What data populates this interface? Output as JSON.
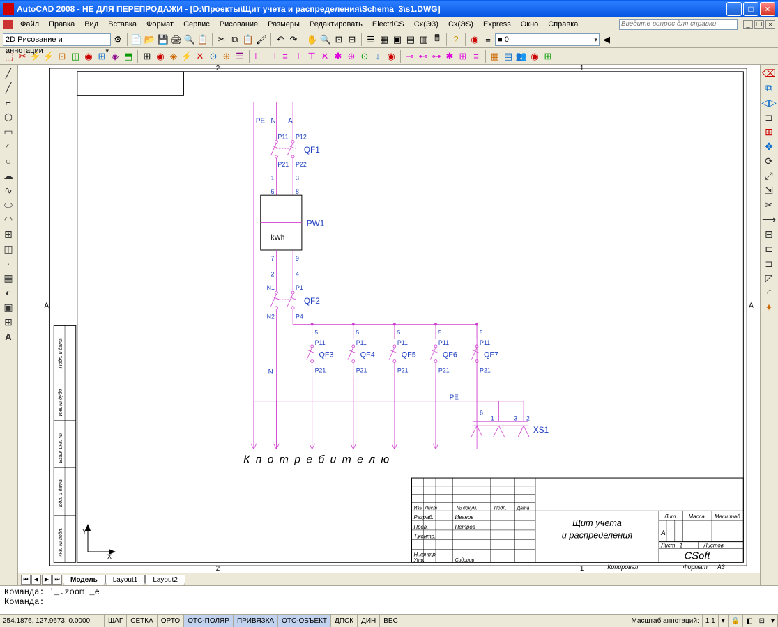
{
  "window": {
    "title": "AutoCAD 2008 - НЕ ДЛЯ ПЕРЕПРОДАЖИ - [D:\\Проекты\\Щит учета и распределения\\Schema_3\\s1.DWG]"
  },
  "menu": {
    "items": [
      "Файл",
      "Правка",
      "Вид",
      "Вставка",
      "Формат",
      "Сервис",
      "Рисование",
      "Размеры",
      "Редактировать",
      "ElectriCS",
      "Cx(ЭЗ)",
      "Cx(ЭS)",
      "Express",
      "Окно",
      "Справка"
    ],
    "help_placeholder": "Введите вопрос для справки"
  },
  "toolbar1": {
    "workspace": "2D Рисование и аннотации",
    "layer": "■ 0"
  },
  "tabs": {
    "items": [
      "Модель",
      "Layout1",
      "Layout2"
    ],
    "active": 0
  },
  "command": {
    "lines": [
      "Команда: '_.zoom _e",
      "Команда:"
    ]
  },
  "status": {
    "coords": "254.1876, 127.9673, 0.0000",
    "toggles": [
      "ШАГ",
      "СЕТКА",
      "ОРТО",
      "ОТС-ПОЛЯР",
      "ПРИВЯЗКА",
      "ОТС-ОБЪЕКТ",
      "ДПСК",
      "ДИН",
      "ВЕС"
    ],
    "active": [
      3,
      4,
      5
    ],
    "anno_label": "Масштаб аннотаций:",
    "anno_scale": "1:1"
  },
  "schematic": {
    "N": "N",
    "A": "A",
    "PE": "PE",
    "P11": "P11",
    "P12": "P12",
    "P21": "P21",
    "P22": "P22",
    "QF1": "QF1",
    "QF2": "QF2",
    "QF3": "QF3",
    "QF4": "QF4",
    "QF5": "QF5",
    "QF6": "QF6",
    "QF7": "QF7",
    "n1": "1",
    "n3": "3",
    "n6": "6",
    "n8": "8",
    "n7": "7",
    "n9": "9",
    "n2": "2",
    "n4": "4",
    "n5": "5",
    "N1": "N1",
    "N2": "N2",
    "P1": "P1",
    "P4": "P4",
    "PW1": "PW1",
    "kWh": "kWh",
    "XS1": "XS1",
    "consumer": "К   п о т р е б и т е л ю",
    "marker_A": "A",
    "marker_1": "1",
    "marker_2": "2"
  },
  "titleblock": {
    "title1": "Щит учета",
    "title2": "и распределения",
    "company": "CSoft",
    "h_izm": "Изм",
    "h_list": "Лист",
    "h_ndoc": "№ докум.",
    "h_podp": "Подп.",
    "h_data": "Дата",
    "r_razrab": "Разраб.",
    "r_prov": "Пров.",
    "r_tkontr": "Т.контр.",
    "r_nkontr": "Н.контр.",
    "r_utv": "Утв.",
    "n_ivanov": "Иванов",
    "n_petrov": "Петров",
    "n_sidorov": "Сидоров",
    "lit": "Лит.",
    "massa": "Масса",
    "mash": "Масштаб",
    "a": "А",
    "list": "Лист",
    "list_n": "1",
    "listov": "Листов",
    "kopirov": "Копировал",
    "format": "Формат",
    "format_v": "А3",
    "side1": "Подп. и дата",
    "side2": "Инв.№ дубл.",
    "side3": "Взам. инв. №",
    "side4": "Подп. и дата",
    "side5": "Инв. № подл."
  }
}
